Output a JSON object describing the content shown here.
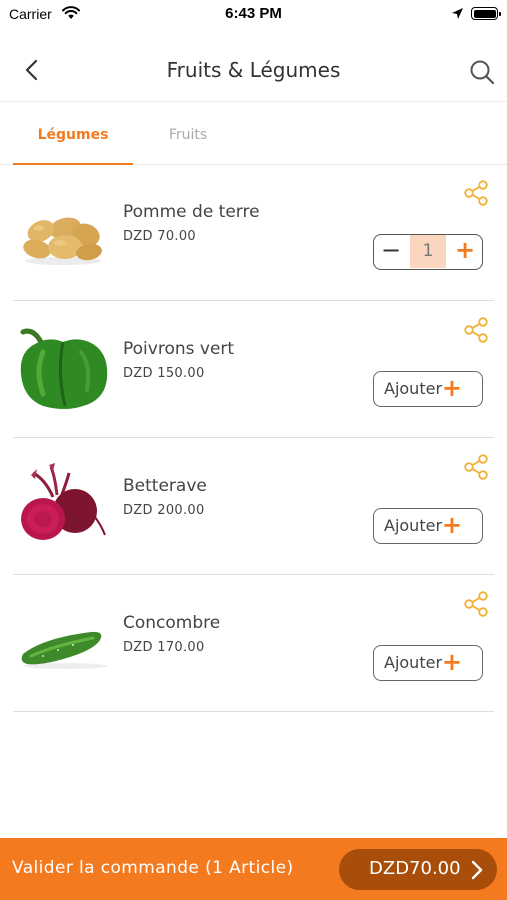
{
  "status_bar": {
    "carrier": "Carrier",
    "time": "6:43 PM",
    "icons": [
      "wifi-icon",
      "location-arrow-icon",
      "battery-icon"
    ]
  },
  "nav": {
    "title": "Fruits & Légumes",
    "back_icon": "chevron-left-icon",
    "search_icon": "search-icon"
  },
  "tabs": [
    {
      "label": "Légumes",
      "active": true
    },
    {
      "label": "Fruits",
      "active": false
    }
  ],
  "products": [
    {
      "name": "Pomme de terre",
      "price": "DZD 70.00",
      "quantity": "1",
      "in_cart": true,
      "image": "potatoes"
    },
    {
      "name": "Poivrons vert",
      "price": "DZD 150.00",
      "button": "Ajouter",
      "plus": "+",
      "image": "green-pepper"
    },
    {
      "name": "Betterave",
      "price": "DZD 200.00",
      "button": "Ajouter",
      "plus": "+",
      "image": "beetroot"
    },
    {
      "name": "Concombre",
      "price": "DZD 170.00",
      "button": "Ajouter",
      "plus": "+",
      "image": "cucumber"
    }
  ],
  "stepper": {
    "minus": "−",
    "plus": "+"
  },
  "checkout": {
    "label": "Valider la commande (1 Article)",
    "total": "DZD70.00"
  },
  "colors": {
    "accent": "#f47a20",
    "accent_dark": "#a94d0b",
    "share_icon": "#f0b13a",
    "stepper_value_bg": "#f9d6bd"
  }
}
